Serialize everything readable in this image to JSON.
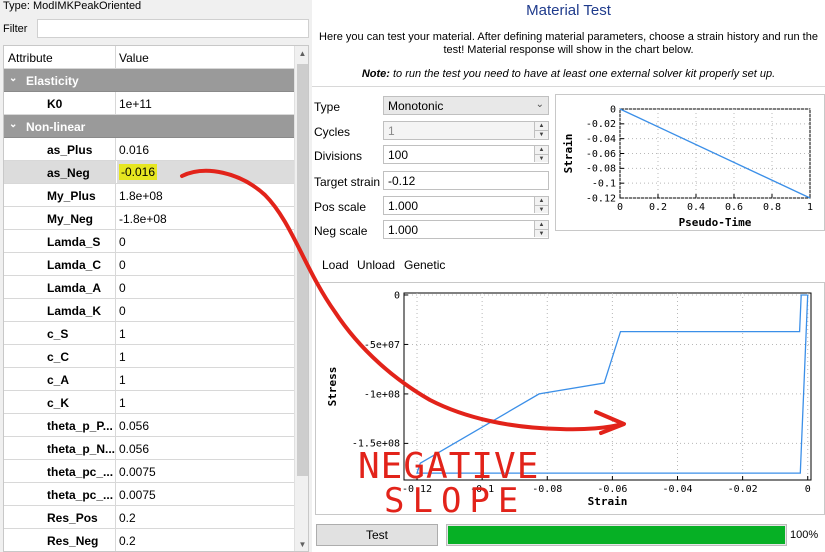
{
  "header": {
    "type_line": "Type:  ModIMKPeakOriented",
    "filter_label": "Filter",
    "filter_value": ""
  },
  "grid": {
    "col_attribute": "Attribute",
    "col_value": "Value",
    "rows": [
      {
        "kind": "group",
        "label": "Elasticity"
      },
      {
        "kind": "param",
        "name": "K0",
        "value": "1e+11"
      },
      {
        "kind": "group",
        "label": "Non-linear"
      },
      {
        "kind": "param",
        "name": "as_Plus",
        "value": "0.016"
      },
      {
        "kind": "param",
        "name": "as_Neg",
        "value": "-0.016",
        "selected": true
      },
      {
        "kind": "param",
        "name": "My_Plus",
        "value": "1.8e+08"
      },
      {
        "kind": "param",
        "name": "My_Neg",
        "value": "-1.8e+08"
      },
      {
        "kind": "param",
        "name": "Lamda_S",
        "value": "0"
      },
      {
        "kind": "param",
        "name": "Lamda_C",
        "value": "0"
      },
      {
        "kind": "param",
        "name": "Lamda_A",
        "value": "0"
      },
      {
        "kind": "param",
        "name": "Lamda_K",
        "value": "0"
      },
      {
        "kind": "param",
        "name": "c_S",
        "value": "1"
      },
      {
        "kind": "param",
        "name": "c_C",
        "value": "1"
      },
      {
        "kind": "param",
        "name": "c_A",
        "value": "1"
      },
      {
        "kind": "param",
        "name": "c_K",
        "value": "1"
      },
      {
        "kind": "param",
        "name": "theta_p_P...",
        "value": "0.056"
      },
      {
        "kind": "param",
        "name": "theta_p_N...",
        "value": "0.056"
      },
      {
        "kind": "param",
        "name": "theta_pc_...",
        "value": "0.0075"
      },
      {
        "kind": "param",
        "name": "theta_pc_...",
        "value": "0.0075"
      },
      {
        "kind": "param",
        "name": "Res_Pos",
        "value": "0.2"
      },
      {
        "kind": "param",
        "name": "Res_Neg",
        "value": "0.2"
      }
    ]
  },
  "material_test": {
    "title": "Material Test",
    "description_line1": "Here you can test your material. After defining material parameters, choose a strain history and run the",
    "description_line2": "test! Material response will show in the chart below.",
    "note_label": "Note:",
    "note_text": " to run the test you need to have at least one external solver kit properly set up.",
    "form": {
      "type_label": "Type",
      "type_value": "Monotonic",
      "cycles_label": "Cycles",
      "cycles_value": "1",
      "divisions_label": "Divisions",
      "divisions_value": "100",
      "target_label": "Target strain",
      "target_value": "-0.12",
      "pos_label": "Pos scale",
      "pos_value": "1.000",
      "neg_label": "Neg scale",
      "neg_value": "1.000"
    },
    "tabs": [
      "Load",
      "Unload",
      "Genetic"
    ],
    "test_button": "Test",
    "progress": 100,
    "progress_text": "100%"
  },
  "annotation": {
    "line1": "NEGATIVE",
    "line2": "SLOPE",
    "color": "#e2231a"
  },
  "chart_data": [
    {
      "type": "line",
      "title": "",
      "xlabel": "Pseudo-Time",
      "ylabel": "Strain",
      "x": [
        0,
        1
      ],
      "y": [
        0,
        -0.12
      ],
      "xlim": [
        0,
        1
      ],
      "ylim": [
        -0.12,
        0
      ],
      "xticks": [
        "0",
        "0.2",
        "0.4",
        "0.6",
        "0.8",
        "1"
      ],
      "xtick_values": [
        0,
        0.2,
        0.4,
        0.6,
        0.8,
        1
      ],
      "yticks": [
        "0",
        "-0.02",
        "-0.04",
        "-0.06",
        "-0.08",
        "-0.1",
        "-0.12"
      ],
      "ytick_values": [
        0,
        -0.02,
        -0.04,
        -0.06,
        -0.08,
        -0.1,
        -0.12
      ],
      "color": "#3b8fe8",
      "grid": true
    },
    {
      "type": "line",
      "title": "",
      "xlabel": "Strain",
      "ylabel": "Stress",
      "x": [
        0,
        -0.0023,
        -0.12,
        -0.119,
        -0.0825,
        -0.0625,
        -0.0575,
        -0.0025,
        -0.002,
        -0.001,
        0
      ],
      "y": [
        0,
        -180000000.0,
        -180000000.0,
        -170000000.0,
        -100000000.0,
        -89000000.0,
        -37000000.0,
        -37000000.0,
        0,
        0,
        0
      ],
      "xlim": [
        -0.124,
        0.001
      ],
      "ylim": [
        -187000000.0,
        2000000.0
      ],
      "xticks": [
        "-0.12",
        "-0.1",
        "-0.08",
        "-0.06",
        "-0.04",
        "-0.02",
        "0"
      ],
      "xtick_values": [
        -0.12,
        -0.1,
        -0.08,
        -0.06,
        -0.04,
        -0.02,
        0
      ],
      "yticks": [
        "0",
        "-5e+07",
        "-1e+08",
        "-1.5e+08"
      ],
      "ytick_values": [
        0,
        -50000000.0,
        -100000000.0,
        -150000000.0
      ],
      "color": "#3b8fe8",
      "grid": true
    }
  ]
}
